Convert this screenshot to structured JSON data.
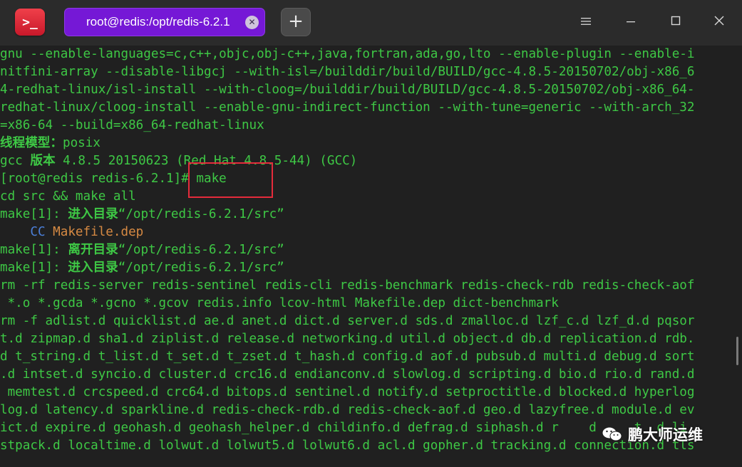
{
  "window": {
    "tab_title": "root@redis:/opt/redis-6.2.1",
    "tab_close": "✕",
    "new_tab": "+",
    "app_icon": ">_"
  },
  "terminal": {
    "lines": [
      [
        {
          "t": "gnu --enable-languages=c,c++,objc,obj-c++,java,fortran,ada,go,lto --enable-plugin --enable-i",
          "c": "green"
        }
      ],
      [
        {
          "t": "nitfini-array --disable-libgcj --with-isl=/builddir/build/BUILD/gcc-4.8.5-20150702/obj-x86_6",
          "c": "green"
        }
      ],
      [
        {
          "t": "4-redhat-linux/isl-install --with-cloog=/builddir/build/BUILD/gcc-4.8.5-20150702/obj-x86_64-",
          "c": "green"
        }
      ],
      [
        {
          "t": "redhat-linux/cloog-install --enable-gnu-indirect-function --with-tune=generic --with-arch_32",
          "c": "green"
        }
      ],
      [
        {
          "t": "=x86-64 --build=x86_64-redhat-linux",
          "c": "green"
        }
      ],
      [
        {
          "t": "线程模型：",
          "c": "bold"
        },
        {
          "t": "posix",
          "c": "green"
        }
      ],
      [
        {
          "t": "gcc ",
          "c": "green"
        },
        {
          "t": "版本",
          "c": "bold"
        },
        {
          "t": " 4.8.5 20150623 (Red Hat 4.8.5-44) (GCC)",
          "c": "green"
        }
      ],
      [
        {
          "t": "[root@redis redis-6.2.1]# make",
          "c": "green"
        }
      ],
      [
        {
          "t": "cd src && make all",
          "c": "green"
        }
      ],
      [
        {
          "t": "make[1]: ",
          "c": "green"
        },
        {
          "t": "进入目录",
          "c": "bold"
        },
        {
          "t": "“/opt/redis-6.2.1/src”",
          "c": "green"
        }
      ],
      [
        {
          "t": "    ",
          "c": "green"
        },
        {
          "t": "CC",
          "c": "blue"
        },
        {
          "t": " ",
          "c": "green"
        },
        {
          "t": "Makefile.dep",
          "c": "orange"
        }
      ],
      [
        {
          "t": "make[1]: ",
          "c": "green"
        },
        {
          "t": "离开目录",
          "c": "bold"
        },
        {
          "t": "“/opt/redis-6.2.1/src”",
          "c": "green"
        }
      ],
      [
        {
          "t": "make[1]: ",
          "c": "green"
        },
        {
          "t": "进入目录",
          "c": "bold"
        },
        {
          "t": "“/opt/redis-6.2.1/src”",
          "c": "green"
        }
      ],
      [
        {
          "t": "rm -rf redis-server redis-sentinel redis-cli redis-benchmark redis-check-rdb redis-check-aof",
          "c": "green"
        }
      ],
      [
        {
          "t": " *.o *.gcda *.gcno *.gcov redis.info lcov-html Makefile.dep dict-benchmark",
          "c": "green"
        }
      ],
      [
        {
          "t": "rm -f adlist.d quicklist.d ae.d anet.d dict.d server.d sds.d zmalloc.d lzf_c.d lzf_d.d pqsor",
          "c": "green"
        }
      ],
      [
        {
          "t": "t.d zipmap.d sha1.d ziplist.d release.d networking.d util.d object.d db.d replication.d rdb.",
          "c": "green"
        }
      ],
      [
        {
          "t": "d t_string.d t_list.d t_set.d t_zset.d t_hash.d config.d aof.d pubsub.d multi.d debug.d sort",
          "c": "green"
        }
      ],
      [
        {
          "t": ".d intset.d syncio.d cluster.d crc16.d endianconv.d slowlog.d scripting.d bio.d rio.d rand.d",
          "c": "green"
        }
      ],
      [
        {
          "t": " memtest.d crcspeed.d crc64.d bitops.d sentinel.d notify.d setproctitle.d blocked.d hyperlog",
          "c": "green"
        }
      ],
      [
        {
          "t": "log.d latency.d sparkline.d redis-check-rdb.d redis-check-aof.d geo.d lazyfree.d module.d ev",
          "c": "green"
        }
      ],
      [
        {
          "t": "ict.d expire.d geohash.d geohash_helper.d childinfo.d defrag.d siphash.d r    d     t  d li",
          "c": "green"
        }
      ],
      [
        {
          "t": "stpack.d localtime.d lolwut.d lolwut5.d lolwut6.d acl.d gopher.d tracking.d connection.d tls",
          "c": "green"
        }
      ]
    ]
  },
  "watermark": {
    "text": "鹏大师运维",
    "icon": "wechat-icon"
  },
  "colors": {
    "green": "#3ec845",
    "blue": "#4b7fd8",
    "orange": "#d78a43",
    "tab_purple": "#7518d6",
    "highlight_red": "#e52b3b"
  }
}
